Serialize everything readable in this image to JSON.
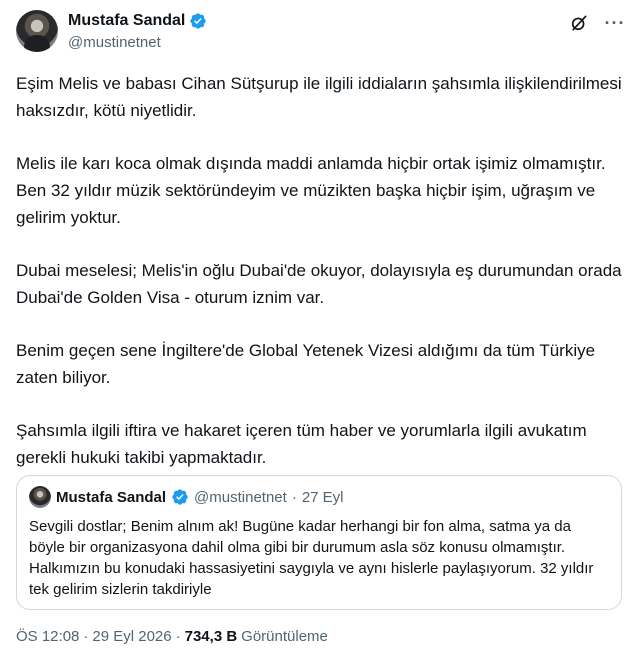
{
  "author": {
    "display_name": "Mustafa Sandal",
    "handle": "@mustinetnet",
    "verified": true
  },
  "tweet": {
    "paragraphs": [
      "Eşim Melis ve babası Cihan Sütşurup ile ilgili iddiaların şahsımla ilişkilendirilmesi haksızdır, kötü niyetlidir.",
      "Melis ile karı koca olmak dışında maddi anlamda hiçbir ortak işimiz olmamıştır. Ben 32 yıldır müzik sektöründeyim ve müzikten başka hiçbir işim, uğraşım ve gelirim yoktur.",
      "Dubai meselesi; Melis'in oğlu Dubai'de okuyor, dolayısıyla eş durumundan orada Dubai'de Golden Visa - oturum iznim var.",
      "Benim geçen sene İngiltere'de Global Yetenek Vizesi aldığımı da tüm Türkiye zaten biliyor.",
      "Şahsımla ilgili iftira ve hakaret içeren tüm haber ve yorumlarla ilgili avukatım gerekli hukuki takibi yapmaktadır."
    ]
  },
  "quote": {
    "display_name": "Mustafa Sandal",
    "handle": "@mustinetnet",
    "separator": "·",
    "date": "27 Eyl",
    "text": "Sevgili dostlar; Benim alnım ak! Bugüne kadar herhangi bir fon alma, satma ya da böyle bir organizasyona dahil olma gibi bir durumum asla söz konusu olmamıştır. Halkımızın bu konudaki hassasiyetini saygıyla ve aynı hislerle paylaşıyorum. 32 yıldır tek gelirim sizlerin takdiriyle"
  },
  "meta": {
    "time": "ÖS 12:08",
    "separator": "·",
    "date": "29 Eyl 2026",
    "separator2": "·",
    "views_count": "734,3 B",
    "views_label": "Görüntüleme"
  },
  "icons": {
    "verified": "verified-badge-icon",
    "grok": "grok-icon",
    "more": "more-icon"
  },
  "colors": {
    "verified_blue": "#1d9bf0",
    "text": "#0f1419",
    "secondary": "#536471",
    "border": "#cfd9de"
  }
}
